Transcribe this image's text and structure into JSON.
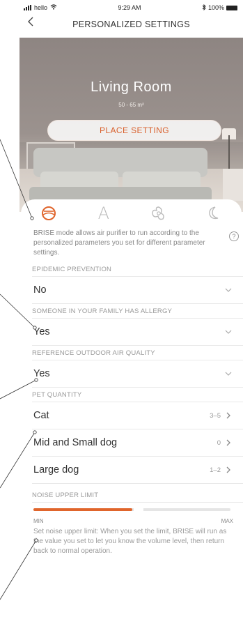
{
  "status": {
    "carrier": "hello",
    "time": "9:29 AM",
    "battery": "100%"
  },
  "nav": {
    "title": "PERSONALIZED SETTINGS"
  },
  "hero": {
    "room_name": "Living Room",
    "area": "50 - 65 m²",
    "place_button": "PLACE SETTING"
  },
  "modes": [
    {
      "icon": "brise-mode-icon",
      "glyph": "",
      "active": true
    },
    {
      "icon": "auto-mode-icon",
      "glyph": "A",
      "active": false
    },
    {
      "icon": "fan-mode-icon",
      "glyph": "",
      "active": false
    },
    {
      "icon": "sleep-mode-icon",
      "glyph": "",
      "active": false
    }
  ],
  "description": "BRISE mode allows air purifier to run according to the personalized parameters you set for different parameter settings.",
  "help_glyph": "?",
  "sections": {
    "epidemic": {
      "title": "EPIDEMIC PREVENTION",
      "value": "No"
    },
    "allergy": {
      "title": "SOMEONE IN YOUR FAMILY HAS ALLERGY",
      "value": "Yes"
    },
    "outdoor": {
      "title": "REFERENCE OUTDOOR AIR QUALITY",
      "value": "Yes"
    },
    "pets": {
      "title": "PET QUANTITY",
      "items": [
        {
          "label": "Cat",
          "value": "3–5"
        },
        {
          "label": "Mid and Small dog",
          "value": "0"
        },
        {
          "label": "Large dog",
          "value": "1–2"
        }
      ]
    },
    "noise": {
      "title": "NOISE UPPER LIMIT",
      "min_label": "MIN",
      "max_label": "MAX",
      "level": 0.5,
      "note": "Set noise upper limit: When you set the limit, BRISE will run as the value you set to let you know the volume level, then return back to normal operation."
    }
  },
  "colors": {
    "accent": "#e0652c",
    "muted": "#999999",
    "text": "#333333"
  }
}
